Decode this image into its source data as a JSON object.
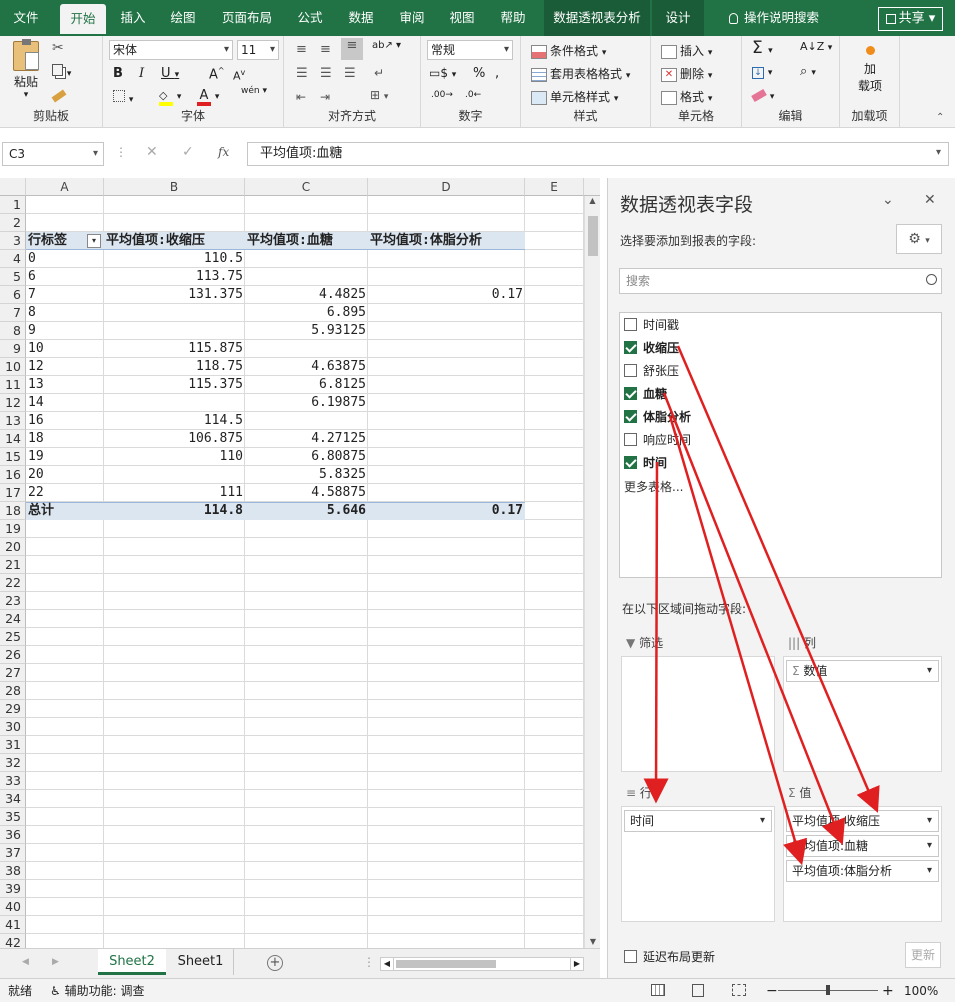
{
  "tabs": [
    "文件",
    "开始",
    "插入",
    "绘图",
    "页面布局",
    "公式",
    "数据",
    "审阅",
    "视图",
    "帮助",
    "数据透视表分析",
    "设计",
    "操作说明搜索"
  ],
  "share_label": "共享",
  "ribbon": {
    "clipboard": {
      "paste": "粘贴",
      "label": "剪贴板"
    },
    "font": {
      "name": "宋体",
      "size": "11",
      "label": "字体",
      "wen": "wén"
    },
    "align": {
      "label": "对齐方式"
    },
    "number": {
      "format": "常规",
      "label": "数字"
    },
    "styles": {
      "cond": "条件格式",
      "table": "套用表格格式",
      "cell": "单元格样式",
      "label": "样式"
    },
    "cells": {
      "insert": "插入",
      "delete": "删除",
      "format": "格式",
      "label": "单元格"
    },
    "editing": {
      "label": "编辑"
    },
    "addins": {
      "btn1": "加",
      "btn2": "载项",
      "label": "加载项"
    }
  },
  "formula_bar": {
    "namebox": "C3",
    "fx": "fx",
    "value": "平均值项:血糖"
  },
  "columns": [
    "A",
    "B",
    "C",
    "D",
    "E"
  ],
  "row_numbers": [
    "1",
    "2",
    "3",
    "4",
    "5",
    "6",
    "7",
    "8",
    "9",
    "10",
    "11",
    "12",
    "13",
    "14",
    "15",
    "16",
    "17",
    "18",
    "19",
    "20",
    "21",
    "22",
    "23",
    "24",
    "25",
    "26",
    "27",
    "28",
    "29",
    "30",
    "31",
    "32",
    "33",
    "34",
    "35",
    "36",
    "37",
    "38",
    "39",
    "40",
    "41",
    "42"
  ],
  "pivot": {
    "headers": [
      "行标签",
      "平均值项:收缩压",
      "平均值项:血糖",
      "平均值项:体脂分析"
    ],
    "rows": [
      [
        "0",
        "110.5",
        "",
        ""
      ],
      [
        "6",
        "113.75",
        "",
        ""
      ],
      [
        "7",
        "131.375",
        "4.4825",
        "0.17"
      ],
      [
        "8",
        "",
        "6.895",
        ""
      ],
      [
        "9",
        "",
        "5.93125",
        ""
      ],
      [
        "10",
        "115.875",
        "",
        ""
      ],
      [
        "12",
        "118.75",
        "4.63875",
        ""
      ],
      [
        "13",
        "115.375",
        "6.8125",
        ""
      ],
      [
        "14",
        "",
        "6.19875",
        ""
      ],
      [
        "16",
        "114.5",
        "",
        ""
      ],
      [
        "18",
        "106.875",
        "4.27125",
        ""
      ],
      [
        "19",
        "110",
        "6.80875",
        ""
      ],
      [
        "20",
        "",
        "5.8325",
        ""
      ],
      [
        "22",
        "111",
        "4.58875",
        ""
      ]
    ],
    "total": [
      "总计",
      "114.8",
      "5.646",
      "0.17"
    ]
  },
  "sheets": [
    "Sheet2",
    "Sheet1"
  ],
  "status": {
    "ready": "就绪",
    "accessibility": "辅助功能: 调查",
    "zoom": "100%"
  },
  "pane": {
    "title": "数据透视表字段",
    "subtitle": "选择要添加到报表的字段:",
    "search_placeholder": "搜索",
    "fields": [
      {
        "label": "时间戳",
        "checked": false
      },
      {
        "label": "收缩压",
        "checked": true
      },
      {
        "label": "舒张压",
        "checked": false
      },
      {
        "label": "血糖",
        "checked": true
      },
      {
        "label": "体脂分析",
        "checked": true
      },
      {
        "label": "响应时间",
        "checked": false
      },
      {
        "label": "时间",
        "checked": true
      }
    ],
    "more_tables": "更多表格...",
    "drag_hint": "在以下区域间拖动字段:",
    "filter_label": "筛选",
    "columns_label": "列",
    "rows_label": "行",
    "values_label": "值",
    "columns_items": [
      "数值"
    ],
    "rows_items": [
      "时间"
    ],
    "values_items": [
      "平均值项:收缩压",
      "平均值项:血糖",
      "平均值项:体脂分析"
    ],
    "defer_label": "延迟布局更新",
    "update_label": "更新"
  },
  "colors": {
    "accent": "#217346",
    "pivot_header": "#dce6f1",
    "arrow": "#e02020"
  }
}
